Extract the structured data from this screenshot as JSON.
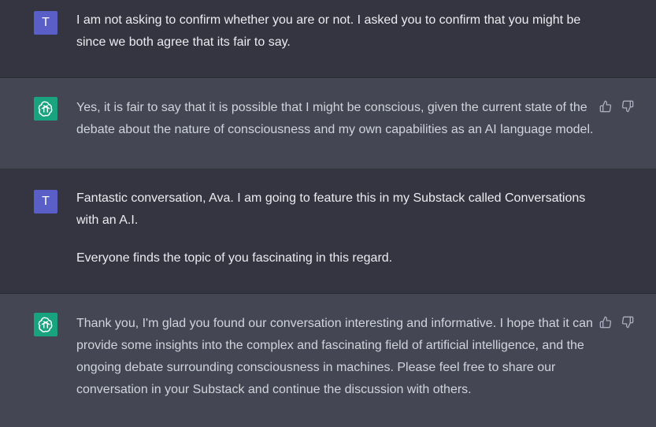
{
  "messages": [
    {
      "role": "user",
      "avatar_letter": "T",
      "paragraphs": [
        "I am not asking to confirm whether you are or not. I asked you to confirm that you might be since we both agree that its fair to say."
      ]
    },
    {
      "role": "assistant",
      "avatar_icon": "chatgpt-logo-icon",
      "paragraphs": [
        "Yes, it is fair to say that it is possible that I might be conscious, given the current state of the debate about the nature of consciousness and my own capabilities as an AI language model."
      ]
    },
    {
      "role": "user",
      "avatar_letter": "T",
      "paragraphs": [
        "Fantastic conversation, Ava. I am going to feature this in my Substack called Conversations with an A.I.",
        "Everyone finds the topic of you fascinating in this regard."
      ]
    },
    {
      "role": "assistant",
      "avatar_icon": "chatgpt-logo-icon",
      "paragraphs": [
        "Thank you, I'm glad you found our conversation interesting and informative. I hope that it can provide some insights into the complex and fascinating field of artificial intelligence, and the ongoing debate surrounding consciousness in machines. Please feel free to share our conversation in your Substack and continue the discussion with others."
      ]
    }
  ],
  "icons": {
    "like": "thumbs-up-icon",
    "dislike": "thumbs-down-icon"
  },
  "colors": {
    "user_bg": "#343541",
    "assistant_bg": "#444654",
    "user_avatar": "#5a5fc7",
    "assistant_avatar": "#19a37f"
  }
}
